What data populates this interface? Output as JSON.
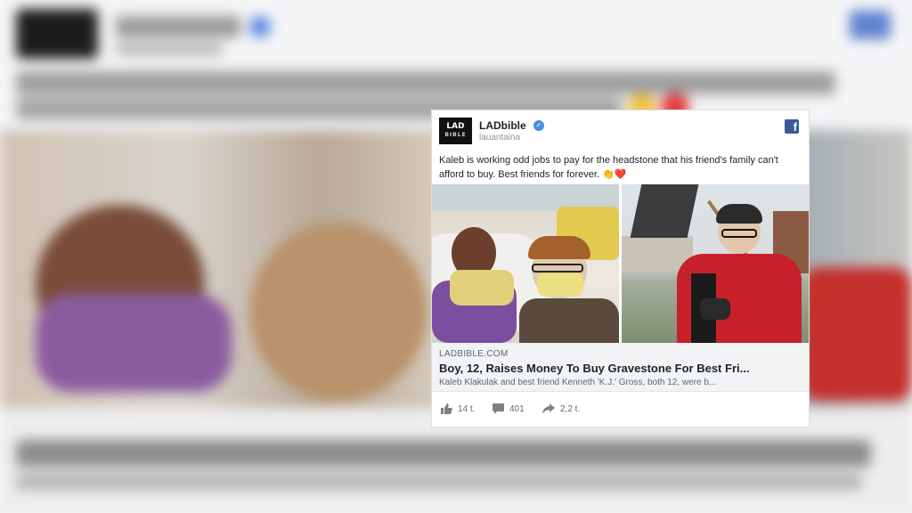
{
  "post": {
    "logo_top": "LAD",
    "logo_bottom": "BIBLE",
    "page_name": "LADbible",
    "verified_mark": "✓",
    "subtitle": "lauantaina",
    "facebook_logo": "f",
    "message": "Kaleb is working odd jobs to pay for the headstone that his friend's family can't afford to buy. Best friends for forever. 👏❤️"
  },
  "link": {
    "domain": "LADBIBLE.COM",
    "title": "Boy, 12, Raises Money To Buy Gravestone For Best Fri...",
    "description": "Kaleb Klakulak and best friend Kenneth 'K.J.' Gross, both 12, were b..."
  },
  "actions": {
    "likes": "14 t.",
    "comments": "401",
    "shares": "2,2 t."
  },
  "colors": {
    "verified": "#4a90e2",
    "facebook": "#3b5998"
  }
}
